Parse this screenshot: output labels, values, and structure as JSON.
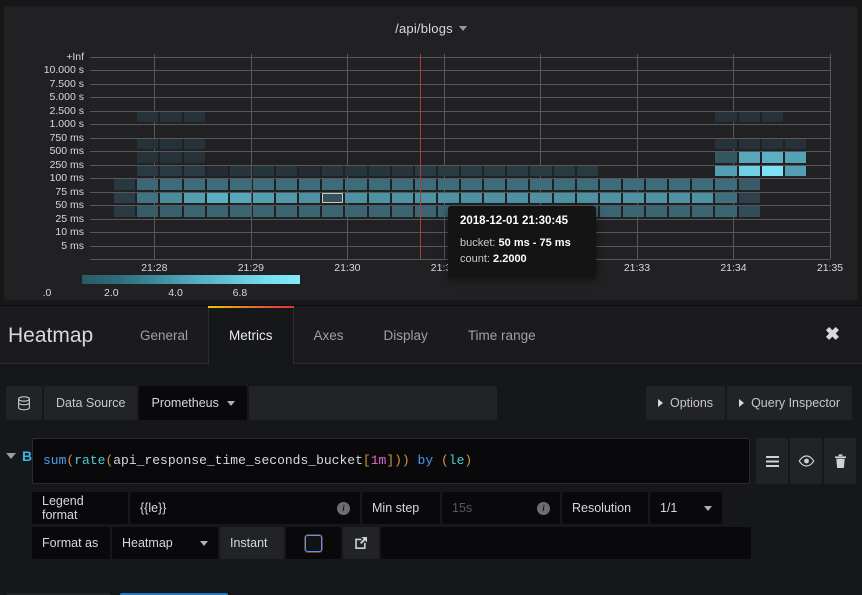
{
  "panel": {
    "title": "/api/blogs",
    "title_caret_icon": "chevron-down-icon"
  },
  "chart_data": {
    "type": "heatmap",
    "title": "/api/blogs",
    "xlabel": "",
    "ylabel": "",
    "grid": true,
    "legend_position": "bottom-left",
    "y_tick_labels": [
      "+Inf",
      "10.000 s",
      "7.500 s",
      "5.000 s",
      "2.500 s",
      "1.000 s",
      "750 ms",
      "500 ms",
      "250 ms",
      "100 ms",
      "75 ms",
      "50 ms",
      "25 ms",
      "10 ms",
      "5 ms"
    ],
    "x_tick_labels": [
      "21:28",
      "21:29",
      "21:30",
      "21:31",
      "21:32",
      "21:33",
      "21:34",
      "21:35"
    ],
    "xlim": [
      "21:27:20",
      "21:35:00"
    ],
    "color_legend": {
      "ticks": [
        ".0",
        "2.0",
        "4.0",
        "6.8"
      ],
      "min": 0,
      "max": 6.8,
      "scheme": "Spectral / cool-blue"
    },
    "crosshair_x": "21:30:45",
    "selected_cell": {
      "time": "2018-12-01 21:30:45",
      "bucket": "50 ms - 75 ms",
      "count": 2.2
    },
    "rows": [
      {
        "bucket": "1.000 s - 2.500 s",
        "cols": [
          0,
          0,
          0.9,
          0.9,
          0.9,
          0,
          0,
          0,
          0,
          0,
          0,
          0,
          0,
          0,
          0,
          0,
          0,
          0,
          0,
          0,
          0,
          0,
          0,
          0,
          0,
          0,
          0,
          0.9,
          0.9,
          0.9,
          0,
          0
        ]
      },
      {
        "bucket": "500 ms - 750 ms",
        "cols": [
          0,
          0,
          0.9,
          0.9,
          0.9,
          0,
          0,
          0,
          0,
          0,
          0,
          0,
          0,
          0,
          0,
          0,
          0,
          0,
          0,
          0,
          0,
          0,
          0,
          0,
          0,
          0,
          0,
          0.9,
          0.9,
          0.9,
          0.9,
          0
        ]
      },
      {
        "bucket": "250 ms - 500 ms",
        "cols": [
          0,
          0,
          0.9,
          0.9,
          0.9,
          0,
          0,
          0,
          0,
          0,
          0,
          0,
          0,
          0,
          0,
          0,
          0,
          0,
          0,
          0,
          0,
          0,
          0,
          0,
          0,
          0,
          0,
          2.4,
          5.2,
          5.4,
          5.1,
          0
        ]
      },
      {
        "bucket": "100 ms - 250 ms",
        "cols": [
          0,
          0,
          1.2,
          1.2,
          1.2,
          0.6,
          1.0,
          1.0,
          1.0,
          0.6,
          1.0,
          1.0,
          1.0,
          1.0,
          1.2,
          1.2,
          1.2,
          1.2,
          1.2,
          1.2,
          1.2,
          1.2,
          0,
          0,
          0,
          0,
          0,
          5.0,
          6.2,
          6.6,
          5.0,
          0
        ]
      },
      {
        "bucket": "75 ms - 100 ms",
        "cols": [
          0,
          1.1,
          3.1,
          3.3,
          3.3,
          3.3,
          3.3,
          3.3,
          3.3,
          3.3,
          3.3,
          3.3,
          3.3,
          3.3,
          3.3,
          3.3,
          3.3,
          3.3,
          3.3,
          3.3,
          3.3,
          3.3,
          3.3,
          3.3,
          3.3,
          3.3,
          3.3,
          3.3,
          2.6,
          0,
          0,
          0
        ]
      },
      {
        "bucket": "50 ms - 75 ms",
        "cols": [
          0,
          1.3,
          3.6,
          4.4,
          5.0,
          5.4,
          5.2,
          5.0,
          4.8,
          4.6,
          2.2,
          4.6,
          4.6,
          4.6,
          4.6,
          4.6,
          4.6,
          4.6,
          4.6,
          4.6,
          4.6,
          4.6,
          4.6,
          4.6,
          4.6,
          4.6,
          4.6,
          3.4,
          1.5,
          0,
          0,
          0
        ]
      },
      {
        "bucket": "25 ms - 50 ms",
        "cols": [
          0,
          1.2,
          2.6,
          2.8,
          3.0,
          3.0,
          3.0,
          3.0,
          3.0,
          3.0,
          3.0,
          3.0,
          3.0,
          3.0,
          3.0,
          3.0,
          3.0,
          3.0,
          3.0,
          3.0,
          3.0,
          3.0,
          3.0,
          3.0,
          3.0,
          3.0,
          3.0,
          3.0,
          2.0,
          0,
          0,
          0
        ]
      }
    ]
  },
  "tooltip": {
    "time": "2018-12-01 21:30:45",
    "bucket_label": "bucket:",
    "bucket_value": "50 ms - 75 ms",
    "count_label": "count:",
    "count_value": "2.2000"
  },
  "editor": {
    "title": "Heatmap",
    "close_icon": "close-icon",
    "tabs": [
      {
        "label": "General",
        "active": false
      },
      {
        "label": "Metrics",
        "active": true
      },
      {
        "label": "Axes",
        "active": false
      },
      {
        "label": "Display",
        "active": false
      },
      {
        "label": "Time range",
        "active": false
      }
    ],
    "datasource": {
      "icon": "database-icon",
      "label": "Data Source",
      "value": "Prometheus",
      "caret_icon": "chevron-down-icon"
    },
    "options_button": "Options",
    "query_inspector_button": "Query Inspector",
    "query": {
      "ref_id": "B",
      "collapse_icon": "chevron-down-icon",
      "expression": "sum(rate(api_response_time_seconds_bucket[1m])) by (le)",
      "tokens": [
        {
          "t": "sum",
          "c": "k-fn"
        },
        {
          "t": "(",
          "c": "k-paren"
        },
        {
          "t": "rate",
          "c": "k-fn2"
        },
        {
          "t": "(",
          "c": "k-paren"
        },
        {
          "t": "api_response_time_seconds_bucket",
          "c": "k-id"
        },
        {
          "t": "[",
          "c": "k-paren"
        },
        {
          "t": "1m",
          "c": "k-num"
        },
        {
          "t": "]",
          "c": "k-paren"
        },
        {
          "t": "))",
          "c": "k-paren"
        },
        {
          "t": " by ",
          "c": "k-fn"
        },
        {
          "t": "(",
          "c": "k-paren"
        },
        {
          "t": "le",
          "c": "k-fn2"
        },
        {
          "t": ")",
          "c": "k-paren"
        }
      ],
      "actions": [
        {
          "name": "query-options-icon",
          "glyph": "hamburger"
        },
        {
          "name": "toggle-visibility-icon",
          "glyph": "eye"
        },
        {
          "name": "delete-query-icon",
          "glyph": "trash"
        }
      ]
    },
    "fields": {
      "legend_format_label": "Legend format",
      "legend_format_value": "{{le}}",
      "min_step_label": "Min step",
      "min_step_placeholder": "15s",
      "min_step_value": "",
      "resolution_label": "Resolution",
      "resolution_value": "1/1",
      "format_as_label": "Format as",
      "format_as_value": "Heatmap",
      "instant_label": "Instant",
      "instant_checked": false,
      "external_link_icon": "external-link-icon"
    }
  }
}
